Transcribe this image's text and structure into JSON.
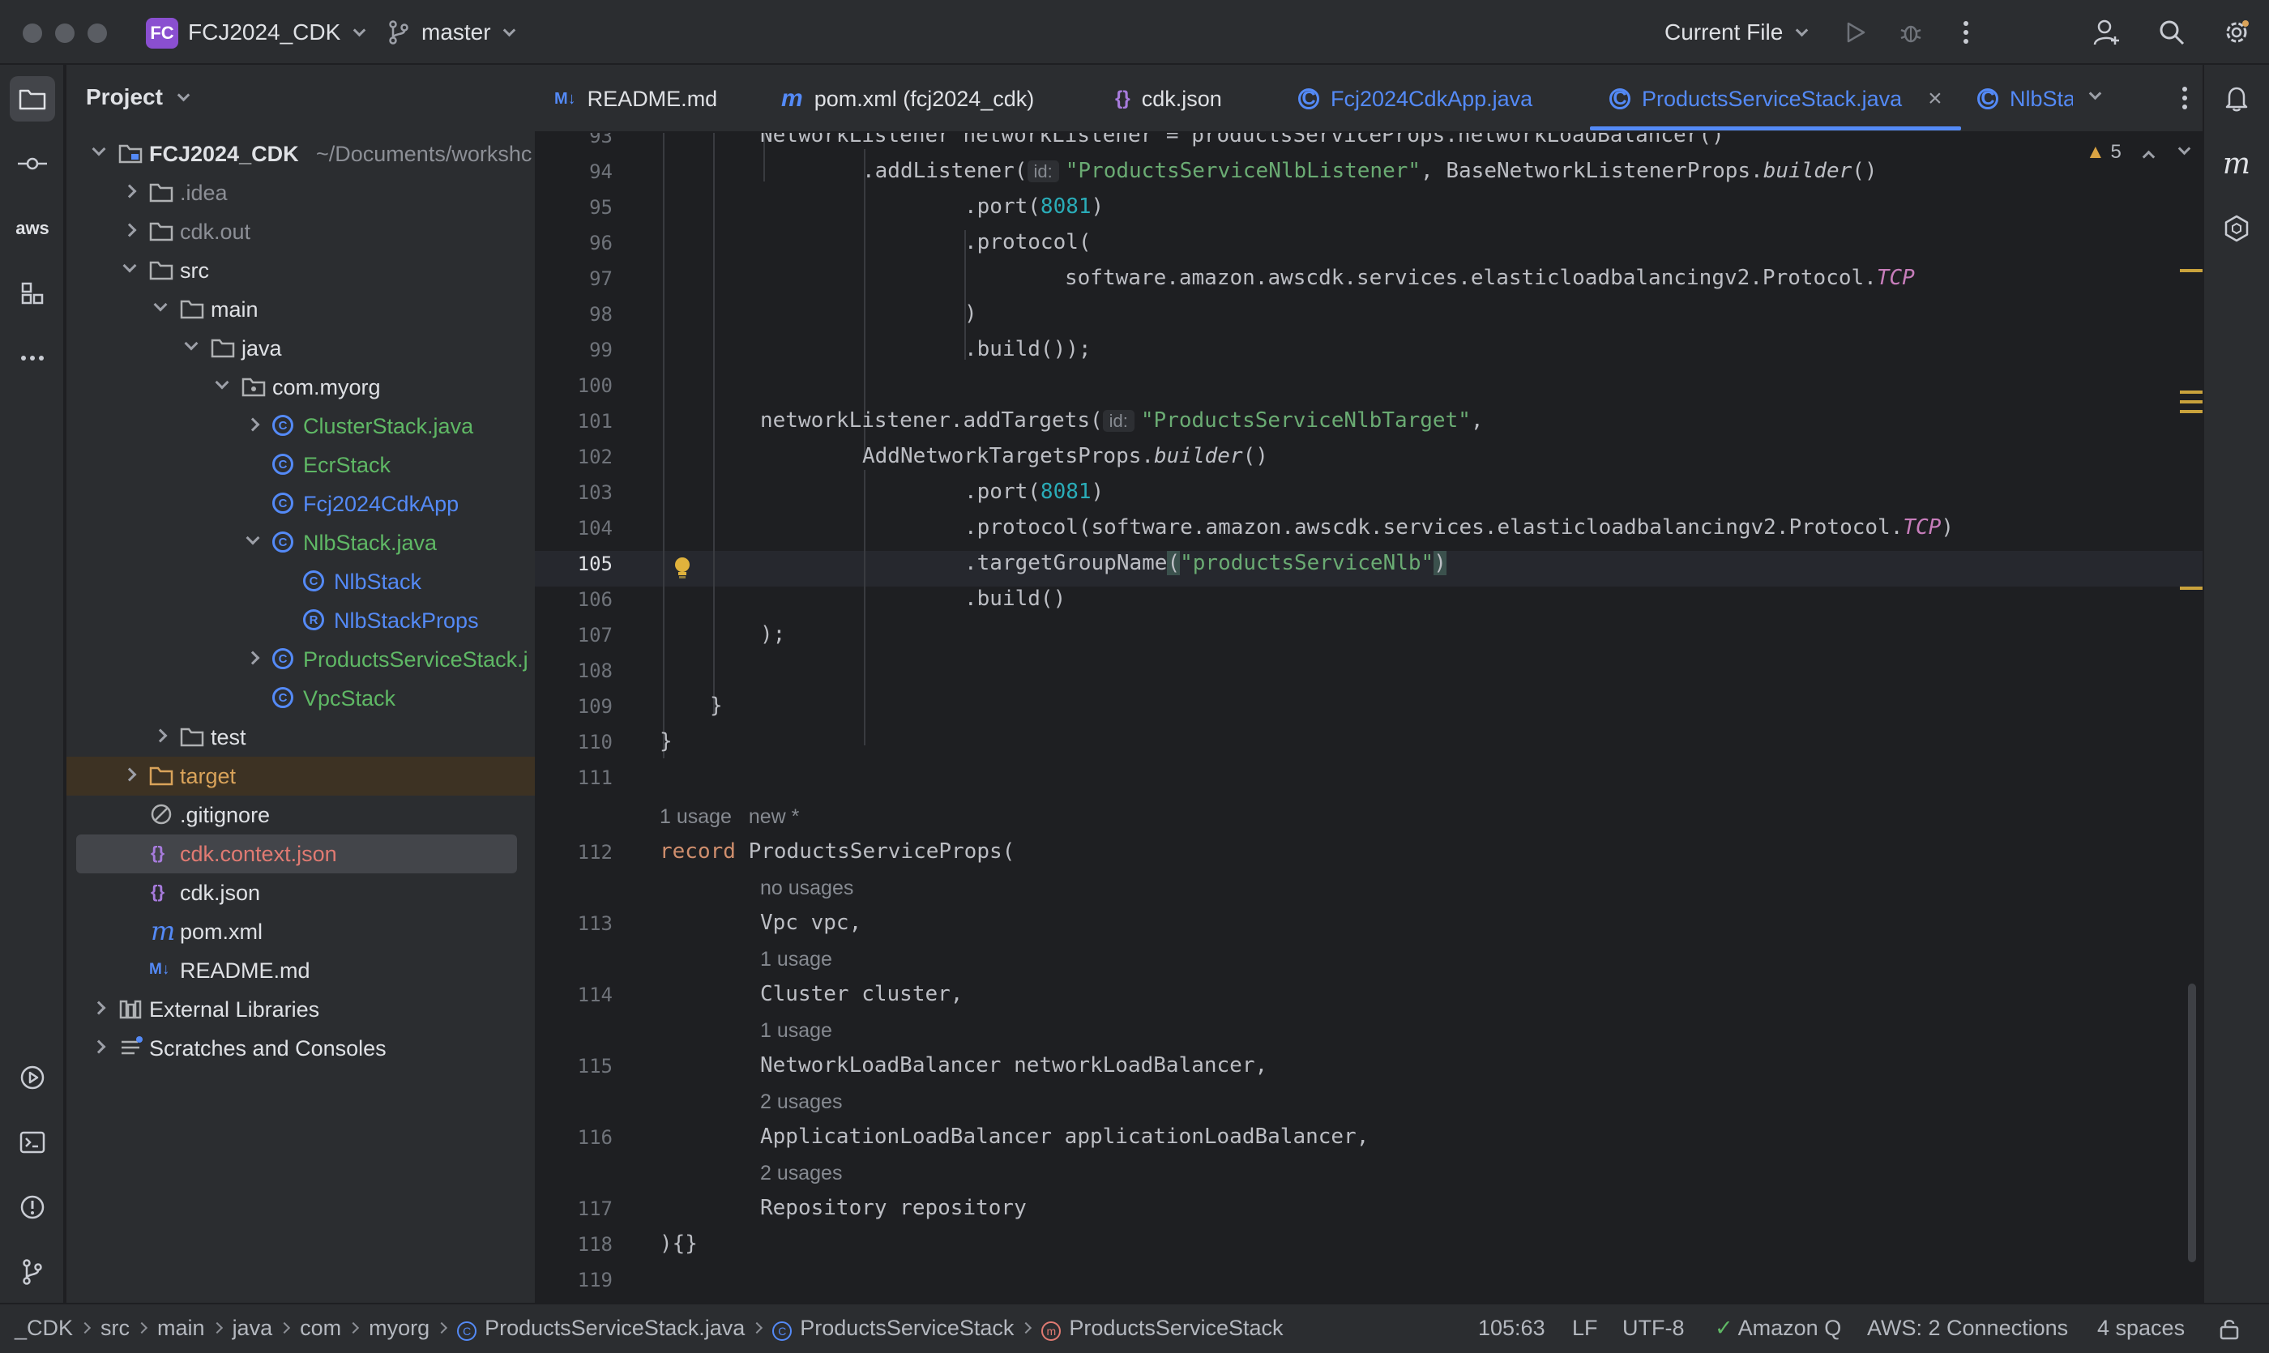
{
  "titlebar": {
    "project_badge": "FC",
    "project_name": "FCJ2024_CDK",
    "branch": "master",
    "run_config": "Current File"
  },
  "project_panel": {
    "title": "Project",
    "tree": [
      {
        "label": "FCJ2024_CDK",
        "suffix": "~/Documents/workshc",
        "kind": "module",
        "expanded": true,
        "depth": 0
      },
      {
        "label": ".idea",
        "kind": "folder",
        "expanded": false,
        "depth": 1
      },
      {
        "label": "cdk.out",
        "kind": "folder",
        "expanded": false,
        "depth": 1
      },
      {
        "label": "src",
        "kind": "folder",
        "expanded": true,
        "depth": 1
      },
      {
        "label": "main",
        "kind": "folder",
        "expanded": true,
        "depth": 2
      },
      {
        "label": "java",
        "kind": "folder",
        "expanded": true,
        "depth": 3
      },
      {
        "label": "com.myorg",
        "kind": "package",
        "expanded": true,
        "depth": 4
      },
      {
        "label": "ClusterStack.java",
        "kind": "class",
        "expanded": false,
        "depth": 5
      },
      {
        "label": "EcrStack",
        "kind": "class",
        "depth": 5
      },
      {
        "label": "Fcj2024CdkApp",
        "kind": "class",
        "depth": 5
      },
      {
        "label": "NlbStack.java",
        "kind": "class",
        "expanded": true,
        "depth": 5
      },
      {
        "label": "NlbStack",
        "kind": "class",
        "depth": 6
      },
      {
        "label": "NlbStackProps",
        "kind": "record",
        "depth": 6
      },
      {
        "label": "ProductsServiceStack.j",
        "kind": "class",
        "expanded": false,
        "depth": 5
      },
      {
        "label": "VpcStack",
        "kind": "class",
        "depth": 5
      },
      {
        "label": "test",
        "kind": "folder",
        "expanded": false,
        "depth": 2
      },
      {
        "label": "target",
        "kind": "folder-excluded",
        "expanded": false,
        "depth": 1
      },
      {
        "label": ".gitignore",
        "kind": "ignore",
        "depth": 1
      },
      {
        "label": "cdk.context.json",
        "kind": "json",
        "depth": 1
      },
      {
        "label": "cdk.json",
        "kind": "json",
        "depth": 1
      },
      {
        "label": "pom.xml",
        "kind": "maven",
        "depth": 1
      },
      {
        "label": "README.md",
        "kind": "markdown",
        "depth": 1
      },
      {
        "label": "External Libraries",
        "kind": "libraries",
        "expanded": false,
        "depth": 0
      },
      {
        "label": "Scratches and Consoles",
        "kind": "scratches",
        "expanded": false,
        "depth": 0
      }
    ]
  },
  "tabs": [
    {
      "icon": "M↓",
      "label": "README.md"
    },
    {
      "icon": "m",
      "label": "pom.xml (fcj2024_cdk)"
    },
    {
      "icon": "{}",
      "label": "cdk.json"
    },
    {
      "icon": "C",
      "label": "Fcj2024CdkApp.java"
    },
    {
      "icon": "C",
      "label": "ProductsServiceStack.java",
      "active": true
    },
    {
      "icon": "C",
      "label": "NlbStacl"
    }
  ],
  "editor": {
    "problems_count": "5",
    "inlay_id": "id:",
    "line_numbers": [
      "93",
      "94",
      "95",
      "96",
      "97",
      "98",
      "99",
      "100",
      "101",
      "102",
      "103",
      "104",
      "105",
      "106",
      "107",
      "108",
      "109",
      "110",
      "111",
      "112",
      "113",
      "114",
      "115",
      "116",
      "117",
      "118",
      "119"
    ],
    "hints": {
      "h1": "1 usage",
      "h1b": "new *",
      "h2": "no usages",
      "h3": "1 usage",
      "h4": "1 usage",
      "h5": "2 usages",
      "h6": "2 usages"
    },
    "code": {
      "l93": "NetworkListener networkListener = productsServiceProps.networkLoadBalancer()",
      "l94a": ".addListener(",
      "l94b": "\"ProductsServiceNlbListener\"",
      "l94c": ", BaseNetworkListenerProps.",
      "l94d": "builder",
      "l94e": "()",
      "l95a": ".port(",
      "l95b": "8081",
      "l95c": ")",
      "l96": ".protocol(",
      "l97a": "software.amazon.awscdk.services.elasticloadbalancingv2.Protocol.",
      "l97b": "TCP",
      "l98": ")",
      "l99": ".build());",
      "l101a": "networkListener.addTargets(",
      "l101b": "\"ProductsServiceNlbTarget\"",
      "l101c": ",",
      "l102a": "AddNetworkTargetsProps.",
      "l102b": "builder",
      "l102c": "()",
      "l103a": ".port(",
      "l103b": "8081",
      "l103c": ")",
      "l104a": ".protocol(software.amazon.awscdk.services.elasticloadbalancingv2.Protocol.",
      "l104b": "TCP",
      "l104c": ")",
      "l105a": ".targetGroupName",
      "l105b": "(",
      "l105c": "\"productsServiceNlb\"",
      "l105d": ")",
      "l106": ".build()",
      "l107": ");",
      "l109": "}",
      "l110": "}",
      "l112a": "record",
      "l112b": " ProductsServiceProps(",
      "l113": "Vpc vpc,",
      "l114": "Cluster cluster,",
      "l115": "NetworkLoadBalancer networkLoadBalancer,",
      "l116": "ApplicationLoadBalancer applicationLoadBalancer,",
      "l117": "Repository repository",
      "l118": "){}"
    }
  },
  "statusbar": {
    "breadcrumbs": [
      "_CDK",
      "src",
      "main",
      "java",
      "com",
      "myorg",
      "ProductsServiceStack.java",
      "ProductsServiceStack",
      "ProductsServiceStack"
    ],
    "position": "105:63",
    "line_separator": "LF",
    "encoding": "UTF-8",
    "amazon_q": "Amazon Q",
    "aws": "AWS: 2 Connections",
    "indent": "4 spaces"
  },
  "colors": {
    "accent": "#548af7",
    "keyword": "#cf8e6d",
    "string": "#6aab73",
    "number": "#2aacb8",
    "constant": "#c77dbb",
    "warning": "#c9a23c"
  }
}
